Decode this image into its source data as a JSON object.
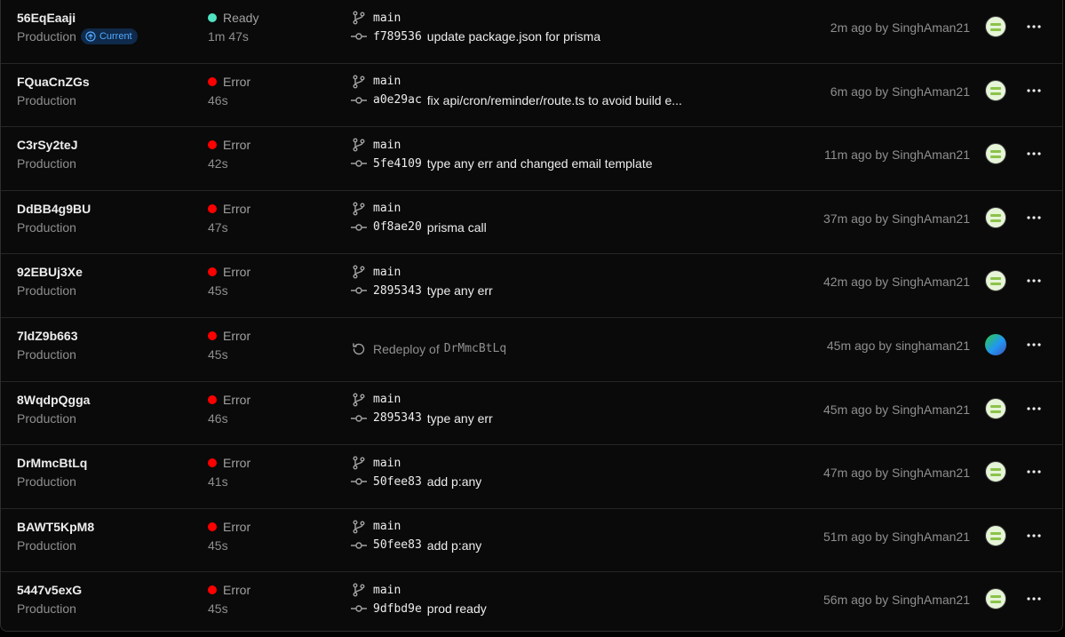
{
  "colors": {
    "ready": "#50e3c2",
    "error": "#ff0000",
    "badge_bg": "#0f2a4a",
    "badge_text": "#52a8ff"
  },
  "deployments": [
    {
      "id": "56EqEaaji",
      "environment": "Production",
      "current_badge": "Current",
      "status": "Ready",
      "status_kind": "ready",
      "duration": "1m 47s",
      "type": "commit",
      "branch": "main",
      "sha": "f789536",
      "message": "update package.json for prisma",
      "meta": "2m ago by SinghAman21",
      "avatar": "pattern"
    },
    {
      "id": "FQuaCnZGs",
      "environment": "Production",
      "status": "Error",
      "status_kind": "error",
      "duration": "46s",
      "type": "commit",
      "branch": "main",
      "sha": "a0e29ac",
      "message": "fix api/cron/reminder/route.ts to avoid build e...",
      "meta": "6m ago by SinghAman21",
      "avatar": "pattern"
    },
    {
      "id": "C3rSy2teJ",
      "environment": "Production",
      "status": "Error",
      "status_kind": "error",
      "duration": "42s",
      "type": "commit",
      "branch": "main",
      "sha": "5fe4109",
      "message": "type any err and changed email template",
      "meta": "11m ago by SinghAman21",
      "avatar": "pattern"
    },
    {
      "id": "DdBB4g9BU",
      "environment": "Production",
      "status": "Error",
      "status_kind": "error",
      "duration": "47s",
      "type": "commit",
      "branch": "main",
      "sha": "0f8ae20",
      "message": "prisma call",
      "meta": "37m ago by SinghAman21",
      "avatar": "pattern"
    },
    {
      "id": "92EBUj3Xe",
      "environment": "Production",
      "status": "Error",
      "status_kind": "error",
      "duration": "45s",
      "type": "commit",
      "branch": "main",
      "sha": "2895343",
      "message": "type any err",
      "meta": "42m ago by SinghAman21",
      "avatar": "pattern"
    },
    {
      "id": "7ldZ9b663",
      "environment": "Production",
      "status": "Error",
      "status_kind": "error",
      "duration": "45s",
      "type": "redeploy",
      "redeploy_label": "Redeploy of",
      "redeploy_of": "DrMmcBtLq",
      "meta": "45m ago by singhaman21",
      "avatar": "gradient"
    },
    {
      "id": "8WqdpQgga",
      "environment": "Production",
      "status": "Error",
      "status_kind": "error",
      "duration": "46s",
      "type": "commit",
      "branch": "main",
      "sha": "2895343",
      "message": "type any err",
      "meta": "45m ago by SinghAman21",
      "avatar": "pattern"
    },
    {
      "id": "DrMmcBtLq",
      "environment": "Production",
      "status": "Error",
      "status_kind": "error",
      "duration": "41s",
      "type": "commit",
      "branch": "main",
      "sha": "50fee83",
      "message": "add p:any",
      "meta": "47m ago by SinghAman21",
      "avatar": "pattern"
    },
    {
      "id": "BAWT5KpM8",
      "environment": "Production",
      "status": "Error",
      "status_kind": "error",
      "duration": "45s",
      "type": "commit",
      "branch": "main",
      "sha": "50fee83",
      "message": "add p:any",
      "meta": "51m ago by SinghAman21",
      "avatar": "pattern"
    },
    {
      "id": "5447v5exG",
      "environment": "Production",
      "status": "Error",
      "status_kind": "error",
      "duration": "45s",
      "type": "commit",
      "branch": "main",
      "sha": "9dfbd9e",
      "message": "prod ready",
      "meta": "56m ago by SinghAman21",
      "avatar": "pattern"
    }
  ]
}
